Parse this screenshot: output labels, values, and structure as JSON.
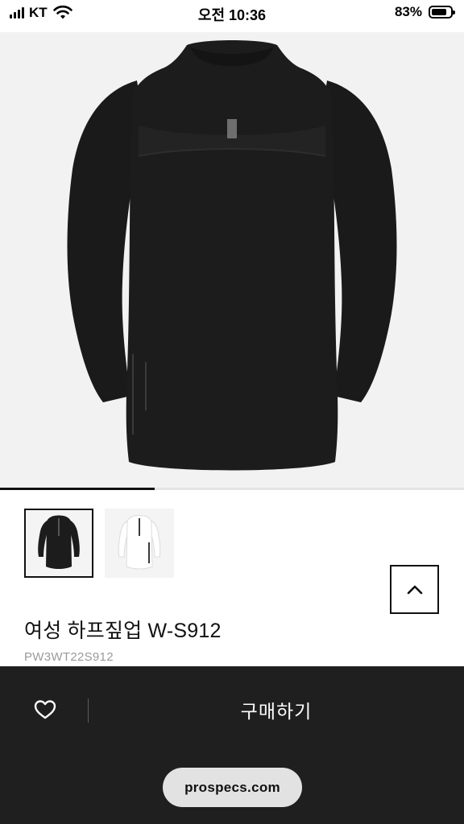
{
  "status_bar": {
    "carrier": "KT",
    "time": "오전 10:36",
    "battery_percent": "83%",
    "battery_level": 0.83,
    "signal_icon": "cellular-signal-icon",
    "wifi_icon": "wifi-icon"
  },
  "product": {
    "name": "여성 하프짚업 W-S912",
    "code": "PW3WT22S912",
    "gallery": {
      "image_count": 3,
      "current_index": 1,
      "thumbnails": [
        {
          "color": "#1c1c1c",
          "selected": true
        },
        {
          "color": "#f3f3f3",
          "selected": false
        }
      ]
    }
  },
  "actions": {
    "scroll_top_icon": "chevron-up-icon",
    "wishlist_icon": "heart-icon",
    "buy_label": "구매하기"
  },
  "browser": {
    "domain": "prospecs.com"
  },
  "colors": {
    "bottom_bar": "#1f1f1f",
    "accent": "#111111",
    "image_background": "#f2f2f2"
  }
}
